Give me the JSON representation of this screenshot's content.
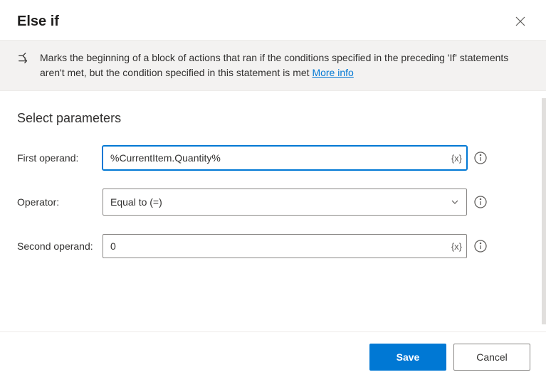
{
  "header": {
    "title": "Else if"
  },
  "banner": {
    "text": "Marks the beginning of a block of actions that ran if the conditions specified in the preceding 'If' statements aren't met, but the condition specified in this statement is met ",
    "link_label": "More info"
  },
  "section_title": "Select parameters",
  "fields": {
    "first_operand": {
      "label": "First operand:",
      "value": "%CurrentItem.Quantity%",
      "token": "{x}"
    },
    "operator": {
      "label": "Operator:",
      "value": "Equal to (=)"
    },
    "second_operand": {
      "label": "Second operand:",
      "value": "0",
      "token": "{x}"
    }
  },
  "footer": {
    "save_label": "Save",
    "cancel_label": "Cancel"
  }
}
